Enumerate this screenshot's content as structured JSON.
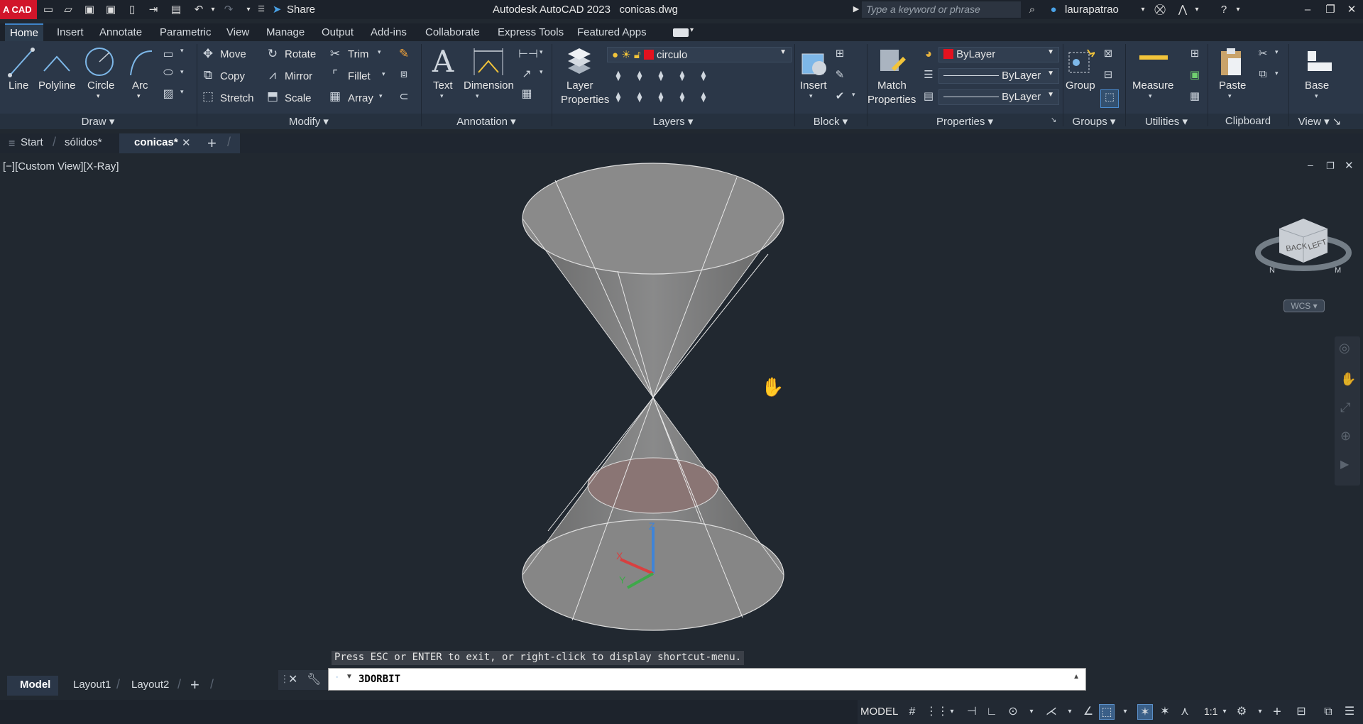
{
  "titlebar": {
    "logo": "A CAD",
    "share_label": "Share",
    "app_title": "Autodesk AutoCAD 2023",
    "file_name": "conicas.dwg",
    "search_placeholder": "Type a keyword or phrase",
    "username": "laurapatrao"
  },
  "ribbon_tabs": [
    "Home",
    "Insert",
    "Annotate",
    "Parametric",
    "View",
    "Manage",
    "Output",
    "Add-ins",
    "Collaborate",
    "Express Tools",
    "Featured Apps"
  ],
  "ribbon": {
    "draw": {
      "title": "Draw",
      "line": "Line",
      "polyline": "Polyline",
      "circle": "Circle",
      "arc": "Arc"
    },
    "modify": {
      "title": "Modify",
      "move": "Move",
      "rotate": "Rotate",
      "trim": "Trim",
      "copy": "Copy",
      "mirror": "Mirror",
      "fillet": "Fillet",
      "stretch": "Stretch",
      "scale": "Scale",
      "array": "Array"
    },
    "annotation": {
      "title": "Annotation",
      "text": "Text",
      "dimension": "Dimension"
    },
    "layers": {
      "title": "Layers",
      "layer_properties_1": "Layer",
      "layer_properties_2": "Properties",
      "current_layer": "circulo"
    },
    "block": {
      "title": "Block",
      "insert": "Insert"
    },
    "properties": {
      "title": "Properties",
      "match_1": "Match",
      "match_2": "Properties",
      "color": "ByLayer",
      "linetype": "ByLayer",
      "lineweight": "ByLayer"
    },
    "groups": {
      "title": "Groups",
      "group": "Group"
    },
    "utilities": {
      "title": "Utilities",
      "measure": "Measure"
    },
    "clipboard": {
      "title": "Clipboard",
      "paste": "Paste"
    },
    "view": {
      "title": "View",
      "base": "Base"
    }
  },
  "doc_tabs": {
    "start": "Start",
    "solidos": "sólidos*",
    "conicas": "conicas*"
  },
  "viewport": {
    "label": "[−][Custom View][X-Ray]",
    "viewcube_back": "BACK",
    "viewcube_left": "LEFT",
    "wcs": "WCS"
  },
  "command": {
    "hint": "Press ESC or ENTER to exit, or right-click to display shortcut-menu.",
    "current": "3DORBIT"
  },
  "layout_tabs": [
    "Model",
    "Layout1",
    "Layout2"
  ],
  "status": {
    "model": "MODEL",
    "scale": "1:1"
  },
  "colors": {
    "accent": "#3f84c8",
    "layer_red": "#e3121f",
    "logo_red": "#d1152a"
  }
}
